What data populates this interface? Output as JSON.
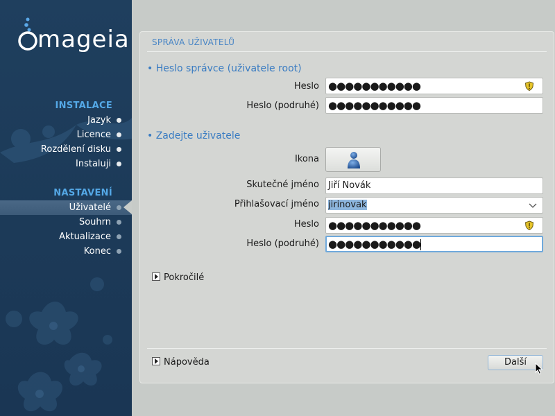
{
  "sidebar": {
    "logo_text": "mageia",
    "sections": [
      {
        "title": "INSTALACE",
        "items": [
          {
            "label": "Jazyk"
          },
          {
            "label": "Licence"
          },
          {
            "label": "Rozdělení disku"
          },
          {
            "label": "Instaluji"
          }
        ]
      },
      {
        "title": "NASTAVENÍ",
        "items": [
          {
            "label": "Uživatelé",
            "active": true
          },
          {
            "label": "Souhrn"
          },
          {
            "label": "Aktualizace"
          },
          {
            "label": "Konec"
          }
        ]
      }
    ]
  },
  "page": {
    "title": "SPRÁVA UŽIVATELŮ",
    "root_section": {
      "title": "• Heslo správce (uživatele root)",
      "password_label": "Heslo",
      "password_value": "●●●●●●●●●●●",
      "password_confirm_label": "Heslo (podruhé)",
      "password_confirm_value": "●●●●●●●●●●●"
    },
    "user_section": {
      "title": "• Zadejte uživatele",
      "icon_label": "Ikona",
      "realname_label": "Skutečné jméno",
      "realname_value": "Jiří Novák",
      "login_label": "Přihlašovací jméno",
      "login_value": "jirinovak",
      "password_label": "Heslo",
      "password_value": "●●●●●●●●●●●",
      "password_confirm_label": "Heslo (podruhé)",
      "password_confirm_value": "●●●●●●●●●●●"
    },
    "advanced_label": "Pokročilé",
    "help_label": "Nápověda",
    "next_label": "Další"
  },
  "icons": {
    "password_strength": "shield-icon",
    "user_avatar": "user-icon",
    "combo": "chevron-down-icon"
  },
  "colors": {
    "sidebar_bg": "#1f3f5e",
    "accent": "#3a7cc2",
    "sidebar_section": "#54a8e6"
  }
}
